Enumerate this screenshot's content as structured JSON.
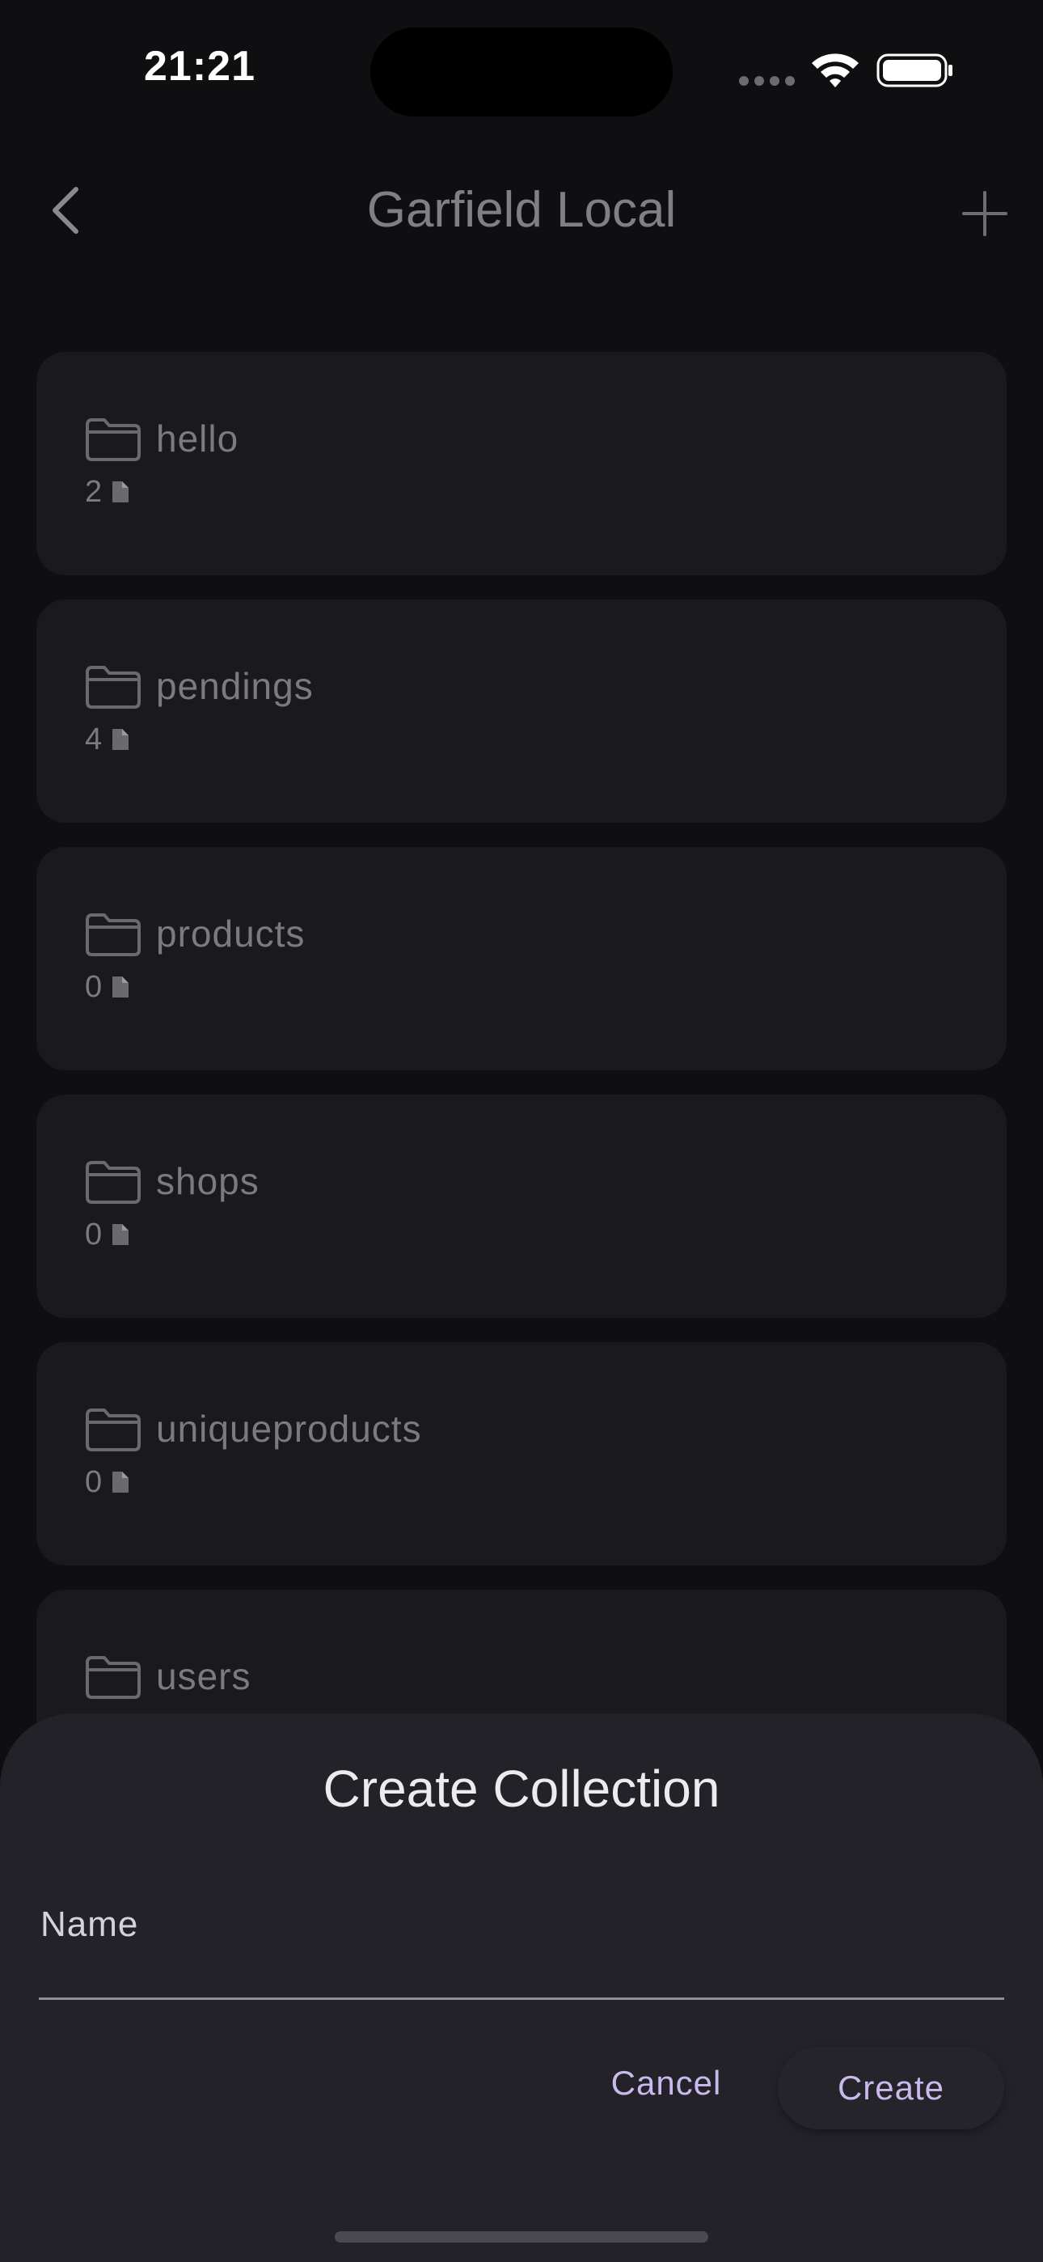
{
  "status_bar": {
    "time": "21:21"
  },
  "nav": {
    "title": "Garfield Local",
    "back_icon": "chevron-left-icon",
    "add_icon": "plus-icon"
  },
  "collections": [
    {
      "name": "hello",
      "count": "2"
    },
    {
      "name": "pendings",
      "count": "4"
    },
    {
      "name": "products",
      "count": "0"
    },
    {
      "name": "shops",
      "count": "0"
    },
    {
      "name": "uniqueproducts",
      "count": "0"
    },
    {
      "name": "users",
      "count": ""
    }
  ],
  "dialog": {
    "title": "Create Collection",
    "name_label": "Name",
    "name_value": "",
    "cancel_label": "Cancel",
    "create_label": "Create"
  },
  "colors": {
    "background": "#0f0f11",
    "card": "#1a1a1c",
    "sheet": "#232229",
    "accent": "#c9b9ec"
  }
}
